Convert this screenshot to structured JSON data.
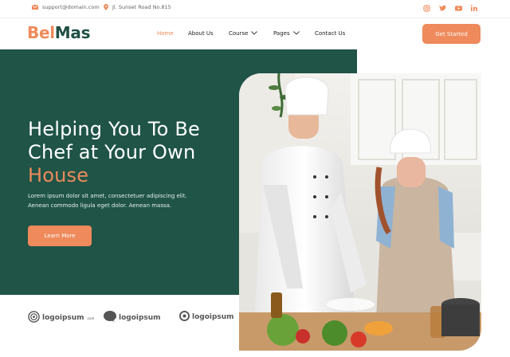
{
  "topbar": {
    "email": "support@domain.com",
    "address": "Jl. Sunset Road No.815",
    "social": [
      "instagram-icon",
      "twitter-icon",
      "youtube-icon",
      "linkedin-icon"
    ],
    "icon_color": "#ee8a5b"
  },
  "header": {
    "logo_part1": "Bel",
    "logo_part2": "Mas",
    "nav": [
      {
        "label": "Home",
        "active": true
      },
      {
        "label": "About Us"
      },
      {
        "label": "Course",
        "dropdown": true
      },
      {
        "label": "Pages",
        "dropdown": true
      },
      {
        "label": "Contact Us"
      }
    ],
    "cta": "Get Started"
  },
  "hero": {
    "title_line1": "Helping You To Be",
    "title_line2": "Chef at Your Own",
    "title_accent": "House",
    "desc_line1": "Lorem ipsum dolor sit amet, consectetuer adipiscing elit.",
    "desc_line2": "Aenean commodo ligula eget dolor. Aenean massa.",
    "button": "Learn More"
  },
  "brands": [
    {
      "name": "logoipsum",
      "sub": ".com"
    },
    {
      "name": "logoipsum"
    },
    {
      "name": "logoipsum"
    }
  ],
  "colors": {
    "accent": "#ee8a5b",
    "brand_green": "#1f5447"
  }
}
